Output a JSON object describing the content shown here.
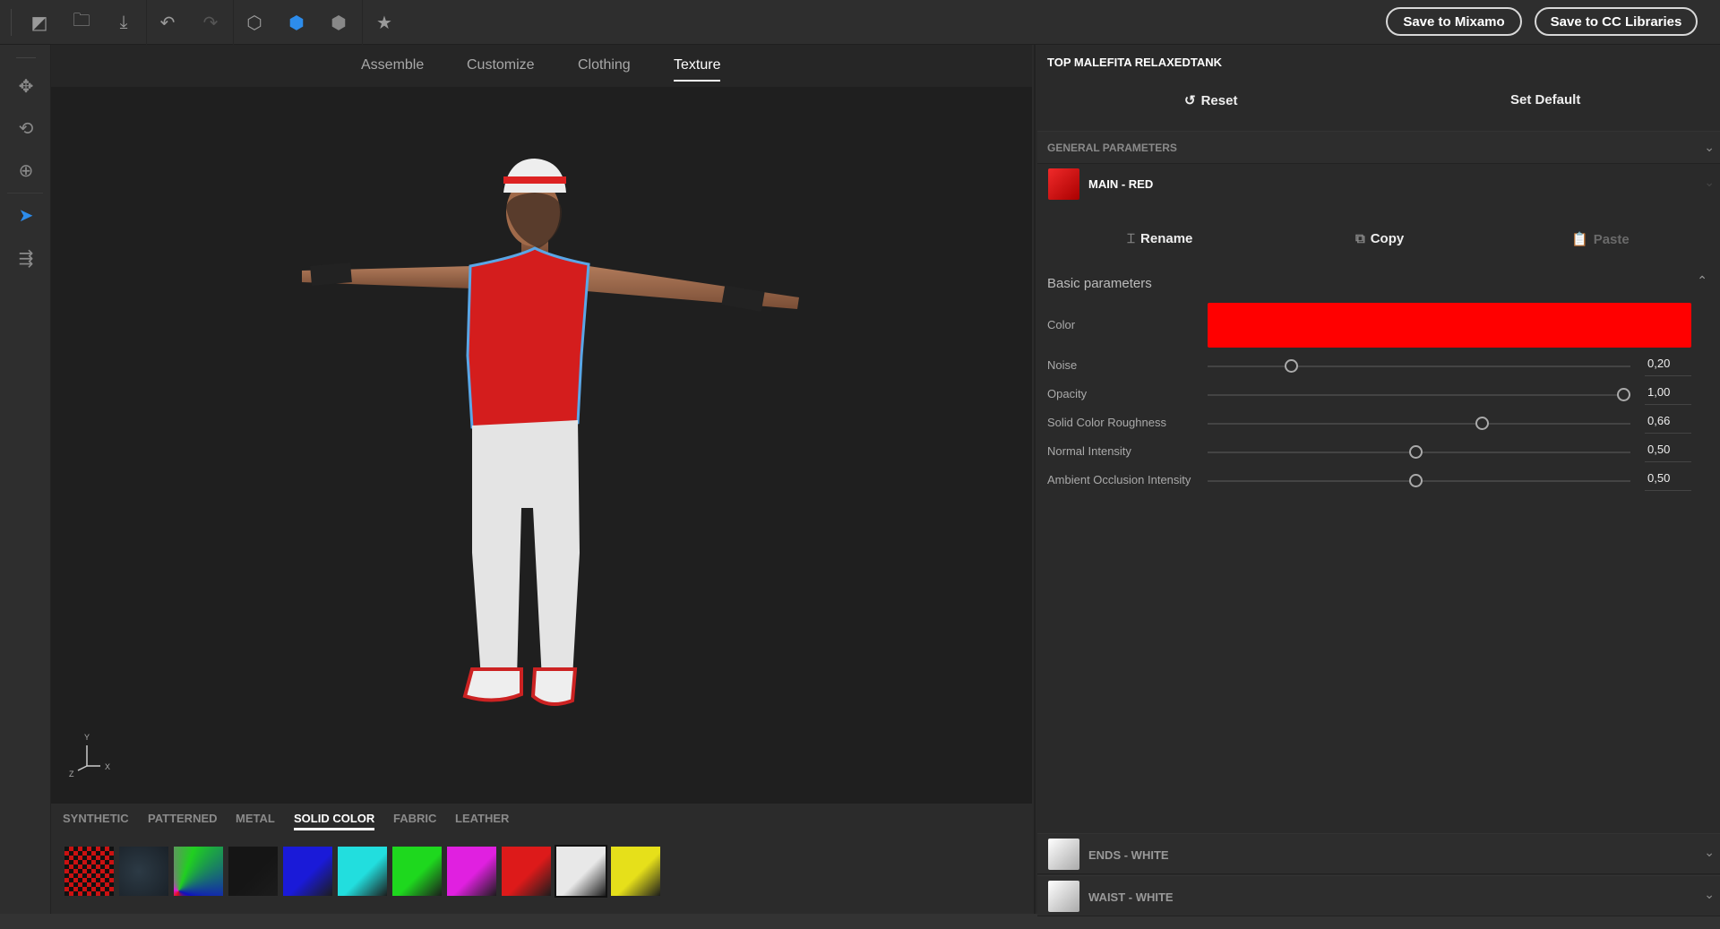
{
  "toolbar": {
    "icons": [
      "panel-icon",
      "folder-open-icon",
      "download-icon",
      "undo-icon",
      "redo-icon",
      "cube-outline-icon",
      "cube-blue-icon",
      "cube-gray-icon",
      "star-icon"
    ],
    "save_mixamo": "Save to Mixamo",
    "save_cc": "Save to CC Libraries"
  },
  "sidebar": {
    "icons": [
      "move-icon",
      "orbit-icon",
      "target-icon",
      "pointer-icon",
      "export-icon"
    ],
    "active_color": "#2d8ceb"
  },
  "viewport": {
    "tabs": [
      {
        "label": "Assemble"
      },
      {
        "label": "Customize"
      },
      {
        "label": "Clothing"
      },
      {
        "label": "Texture",
        "active": true
      }
    ],
    "axes": {
      "y": "Y",
      "x": "X",
      "z": "Z"
    }
  },
  "materials": {
    "tabs": [
      {
        "label": "SYNTHETIC"
      },
      {
        "label": "PATTERNED"
      },
      {
        "label": "METAL"
      },
      {
        "label": "SOLID COLOR",
        "active": true
      },
      {
        "label": "FABRIC"
      },
      {
        "label": "LEATHER"
      }
    ],
    "swatches": [
      "checker-red-black",
      "dark-blue-gray",
      "rgb-gradient",
      "#151515",
      "#1a1ad8",
      "#22dede",
      "#1ed81e",
      "#e020e0",
      "#dd1a1a",
      "#e8e8e8",
      "#e6e01a"
    ]
  },
  "panel": {
    "title": "TOP MALEFITA RELAXEDTANK",
    "reset": "Reset",
    "set_default": "Set Default",
    "general": "GENERAL PARAMETERS",
    "main_material": {
      "name": "MAIN - RED",
      "color": "#e01515"
    },
    "rename": "Rename",
    "copy": "Copy",
    "paste": "Paste",
    "basic": "Basic parameters",
    "color_label": "Color",
    "color_value": "#ff0000",
    "sliders": [
      {
        "label": "Noise",
        "value": "0,20",
        "fraction": 0.2
      },
      {
        "label": "Opacity",
        "value": "1,00",
        "fraction": 1.0
      },
      {
        "label": "Solid Color Roughness",
        "value": "0,66",
        "fraction": 0.66
      },
      {
        "label": "Normal Intensity",
        "value": "0,50",
        "fraction": 0.5
      },
      {
        "label": "Ambient Occlusion Intensity",
        "value": "0,50",
        "fraction": 0.5
      }
    ],
    "other_materials": [
      {
        "name": "ENDS - WHITE"
      },
      {
        "name": "WAIST - WHITE"
      }
    ]
  }
}
